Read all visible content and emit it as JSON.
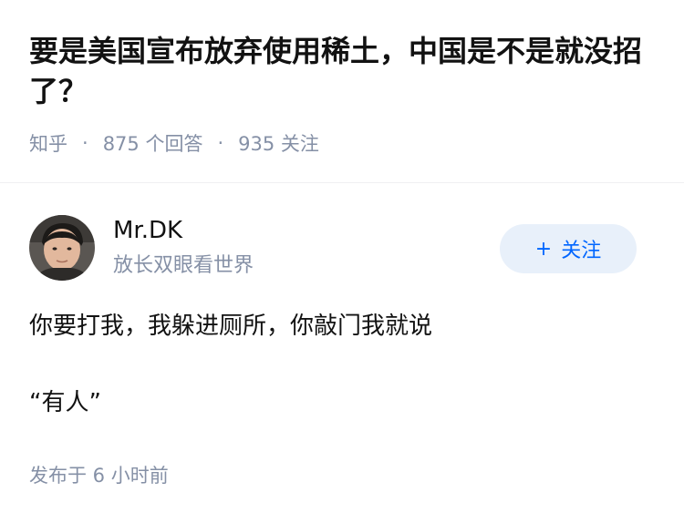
{
  "question": {
    "title": "要是美国宣布放弃使用稀土，中国是不是就没招了？",
    "source": "知乎",
    "separator": "·",
    "answer_count": "875 个回答",
    "follower_count": "935 关注"
  },
  "answer": {
    "author_name": "Mr.DK",
    "author_bio": "放长双眼看世界",
    "follow_plus": "+",
    "follow_label": "关注",
    "paragraphs": [
      "你要打我，我躲进厕所，你敲门我就说",
      "“有人”"
    ],
    "published_time": "发布于 6 小时前"
  },
  "colors": {
    "meta_gray": "#8590a6",
    "follow_blue": "#0066ff",
    "follow_bg": "#e8f0fa"
  }
}
